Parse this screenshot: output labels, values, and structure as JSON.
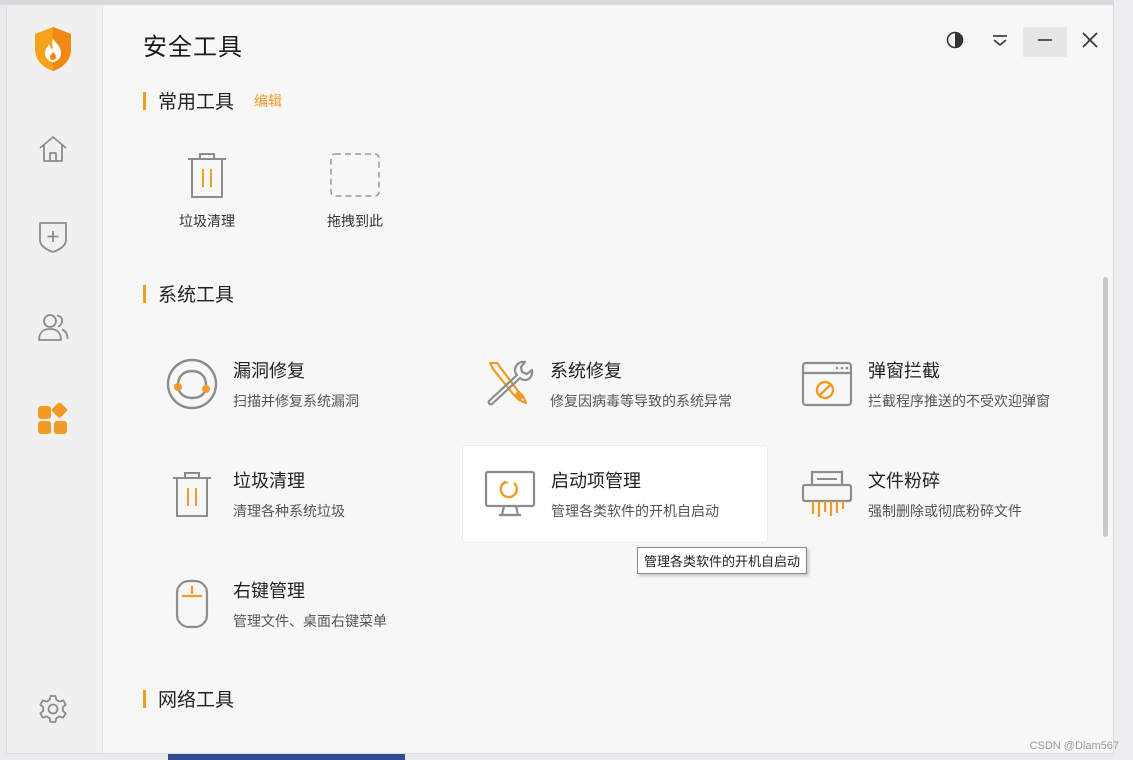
{
  "window": {
    "title": "安全工具"
  },
  "sidebar": {
    "items": [
      {
        "icon": "home-icon"
      },
      {
        "icon": "shield-plus-icon"
      },
      {
        "icon": "users-icon"
      },
      {
        "icon": "apps-icon",
        "active": true
      },
      {
        "icon": "settings-icon"
      }
    ]
  },
  "sections": {
    "common": {
      "title": "常用工具",
      "edit": "编辑"
    },
    "system": {
      "title": "系统工具"
    },
    "network": {
      "title": "网络工具"
    }
  },
  "quick": [
    {
      "label": "垃圾清理",
      "icon": "trash-icon"
    },
    {
      "label": "拖拽到此",
      "icon": "dashed-placeholder-icon"
    }
  ],
  "tools": [
    {
      "name": "漏洞修复",
      "desc": "扫描并修复系统漏洞",
      "icon": "vulnerability-fix-icon"
    },
    {
      "name": "系统修复",
      "desc": "修复因病毒等导致的系统异常",
      "icon": "wrench-screwdriver-icon"
    },
    {
      "name": "弹窗拦截",
      "desc": "拦截程序推送的不受欢迎弹窗",
      "icon": "popup-block-icon"
    },
    {
      "name": "垃圾清理",
      "desc": "清理各种系统垃圾",
      "icon": "trash-icon"
    },
    {
      "name": "启动项管理",
      "desc": "管理各类软件的开机自启动",
      "icon": "startup-monitor-icon"
    },
    {
      "name": "文件粉碎",
      "desc": "强制删除或彻底粉碎文件",
      "icon": "shredder-icon"
    },
    {
      "name": "右键管理",
      "desc": "管理文件、桌面右键菜单",
      "icon": "mouse-icon"
    }
  ],
  "tooltip": "管理各类软件的开机自启动",
  "watermark": "CSDN @Dlam567",
  "colors": {
    "accent": "#f39a24",
    "icon_gray": "#8c8c8c"
  }
}
